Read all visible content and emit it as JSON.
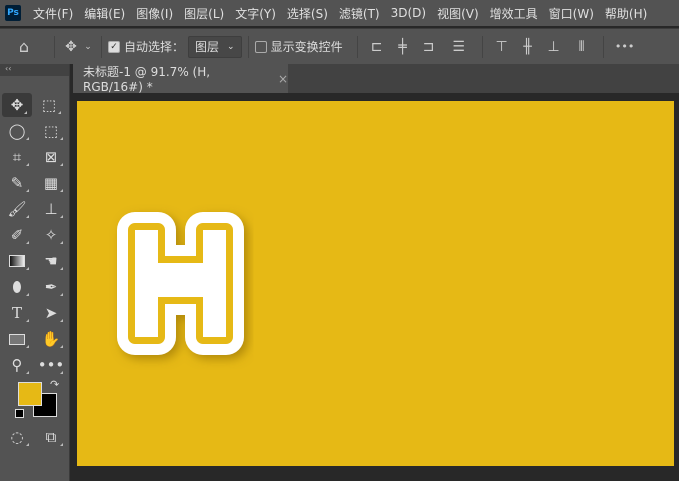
{
  "app": {
    "logo": "Ps"
  },
  "menu": [
    "文件(F)",
    "编辑(E)",
    "图像(I)",
    "图层(L)",
    "文字(Y)",
    "选择(S)",
    "滤镜(T)",
    "3D(D)",
    "视图(V)",
    "增效工具",
    "窗口(W)",
    "帮助(H)"
  ],
  "options": {
    "auto_select_label": "自动选择：",
    "auto_select_checked": true,
    "layer_select": "图层",
    "show_transform_label": "显示变换控件",
    "show_transform_checked": false,
    "more": "•••"
  },
  "document_tab": {
    "title": "未标题-1 @ 91.7% (H, RGB/16#) *",
    "close": "×"
  },
  "canvas": {
    "background": "#e6b915",
    "text": "H",
    "fg_color": "#e6b915",
    "bg_color": "#000000"
  },
  "tools": [
    "move",
    "marquee",
    "lasso",
    "object-select",
    "crop",
    "frame",
    "eyedropper",
    "spot-heal",
    "brush",
    "stamp",
    "history-brush",
    "eraser",
    "gradient",
    "smudge",
    "sponge",
    "pen",
    "type",
    "path-select",
    "rectangle",
    "hand",
    "zoom",
    "more"
  ]
}
